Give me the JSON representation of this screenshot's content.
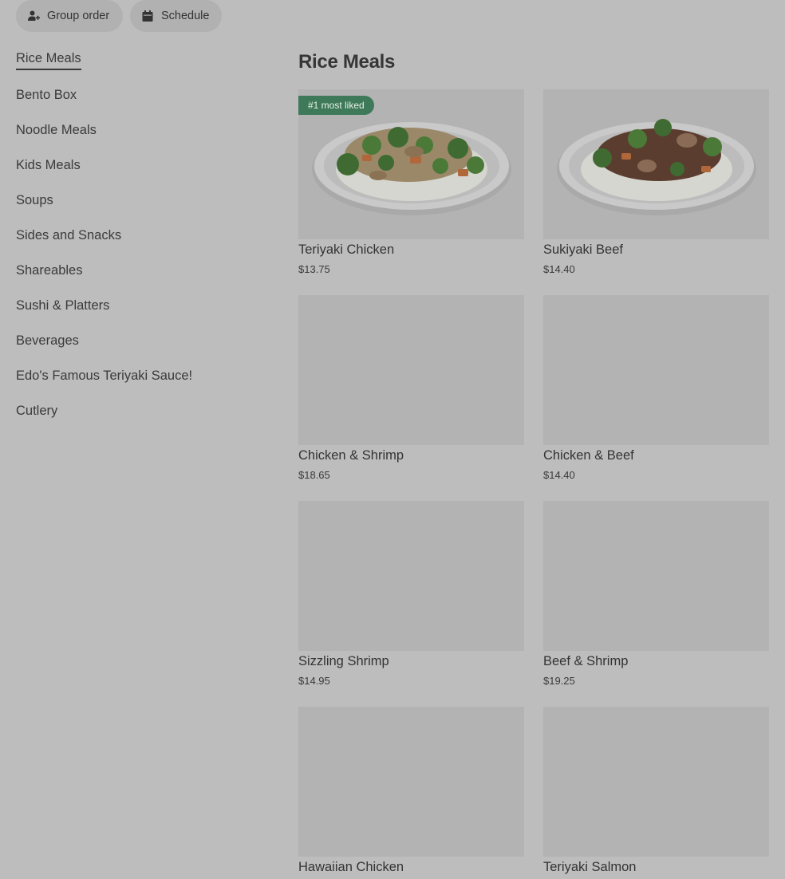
{
  "toolbar": {
    "group_order_label": "Group order",
    "schedule_label": "Schedule"
  },
  "sidebar": {
    "items": [
      {
        "label": "Rice Meals",
        "active": true
      },
      {
        "label": "Bento Box"
      },
      {
        "label": "Noodle Meals"
      },
      {
        "label": "Kids Meals"
      },
      {
        "label": "Soups"
      },
      {
        "label": "Sides and Snacks"
      },
      {
        "label": "Shareables"
      },
      {
        "label": "Sushi & Platters"
      },
      {
        "label": "Beverages"
      },
      {
        "label": "Edo's Famous Teriyaki Sauce!"
      },
      {
        "label": "Cutlery"
      }
    ]
  },
  "main": {
    "title": "Rice Meals",
    "items": [
      {
        "name": "Teriyaki Chicken",
        "price": "$13.75",
        "badge": "#1 most liked",
        "image": "chicken-rice-bowl"
      },
      {
        "name": "Sukiyaki Beef",
        "price": "$14.40",
        "image": "beef-rice-bowl"
      },
      {
        "name": "Chicken & Shrimp",
        "price": "$18.65"
      },
      {
        "name": "Chicken & Beef",
        "price": "$14.40"
      },
      {
        "name": "Sizzling Shrimp",
        "price": "$14.95"
      },
      {
        "name": "Beef & Shrimp",
        "price": "$19.25"
      },
      {
        "name": "Hawaiian Chicken"
      },
      {
        "name": "Teriyaki Salmon"
      }
    ]
  },
  "colors": {
    "overlay_background": "#bdbdbd",
    "badge_green": "#3e7a59",
    "text": "#3a3a3a"
  }
}
